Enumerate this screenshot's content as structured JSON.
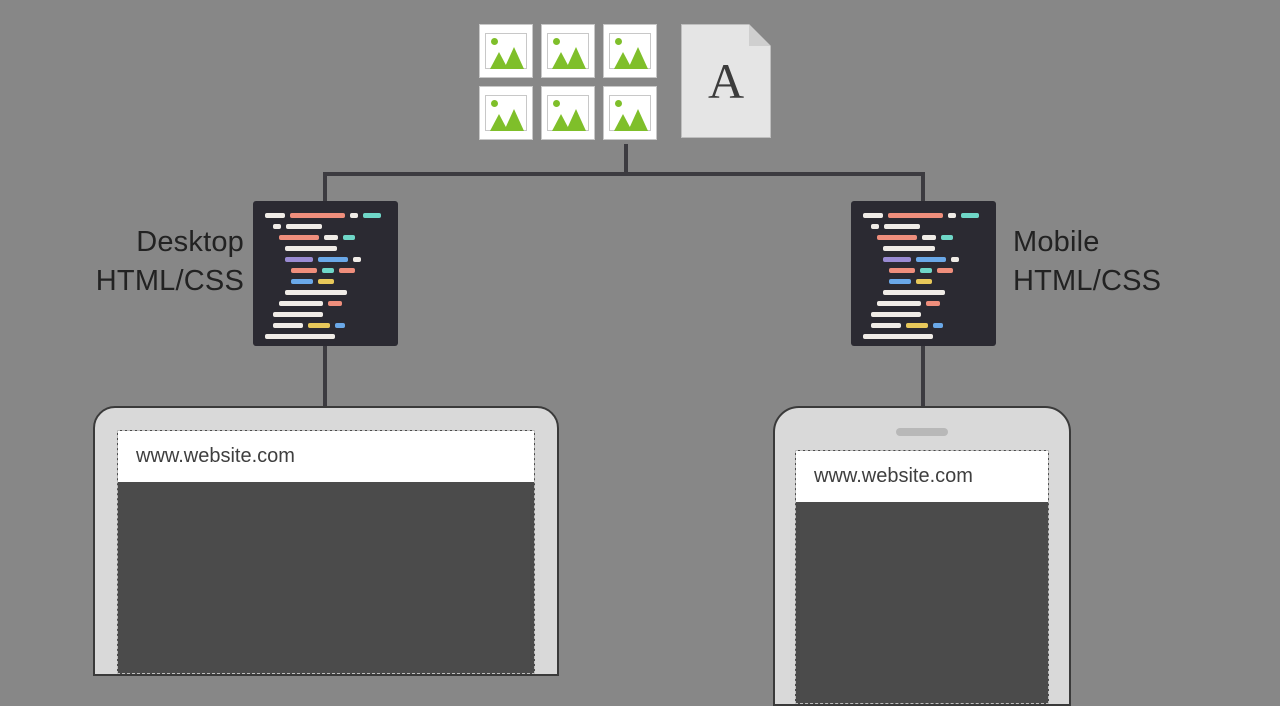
{
  "assets": {
    "font_glyph": "A",
    "image_count": 6
  },
  "labels": {
    "desktop_line1": "Desktop",
    "desktop_line2": "HTML/CSS",
    "mobile_line1": "Mobile",
    "mobile_line2": "HTML/CSS"
  },
  "url": {
    "desktop": "www.website.com",
    "mobile": "www.website.com"
  },
  "code_colors": {
    "white": "#f0ece7",
    "coral": "#ef8e7c",
    "teal": "#6fd7c8",
    "violet": "#9a8bd3",
    "blue": "#6aa8e8",
    "yellow": "#e8c85a"
  },
  "code_lines": [
    {
      "indent": 0,
      "seg": [
        [
          "white",
          20
        ],
        [
          "coral",
          55
        ],
        [
          "white",
          8
        ],
        [
          "teal",
          18
        ]
      ]
    },
    {
      "indent": 8,
      "seg": [
        [
          "white",
          8
        ],
        [
          "white",
          36
        ]
      ]
    },
    {
      "indent": 14,
      "seg": [
        [
          "coral",
          40
        ],
        [
          "white",
          14
        ],
        [
          "teal",
          12
        ]
      ]
    },
    {
      "indent": 20,
      "seg": [
        [
          "white",
          52
        ]
      ]
    },
    {
      "indent": 20,
      "seg": [
        [
          "violet",
          28
        ],
        [
          "blue",
          30
        ],
        [
          "white",
          8
        ]
      ]
    },
    {
      "indent": 26,
      "seg": [
        [
          "coral",
          26
        ],
        [
          "teal",
          12
        ],
        [
          "coral",
          16
        ]
      ]
    },
    {
      "indent": 26,
      "seg": [
        [
          "blue",
          22
        ],
        [
          "yellow",
          16
        ]
      ]
    },
    {
      "indent": 20,
      "seg": [
        [
          "white",
          62
        ]
      ]
    },
    {
      "indent": 14,
      "seg": [
        [
          "white",
          44
        ],
        [
          "coral",
          14
        ]
      ]
    },
    {
      "indent": 8,
      "seg": [
        [
          "white",
          50
        ]
      ]
    },
    {
      "indent": 8,
      "seg": [
        [
          "white",
          30
        ],
        [
          "yellow",
          22
        ],
        [
          "blue",
          10
        ]
      ]
    },
    {
      "indent": 0,
      "seg": [
        [
          "white",
          70
        ]
      ]
    }
  ]
}
